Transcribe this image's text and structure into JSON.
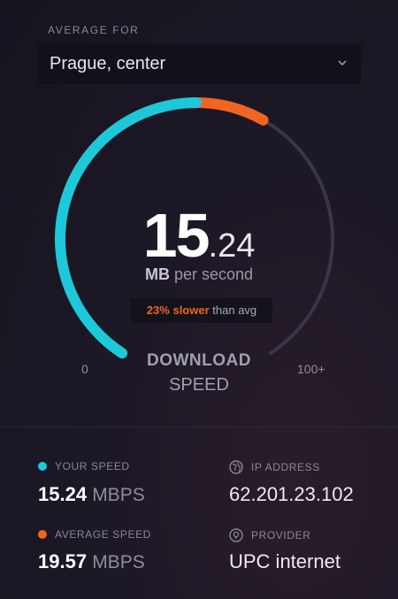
{
  "header": {
    "average_for_label": "AVERAGE FOR",
    "location": "Prague, center"
  },
  "gauge": {
    "speed_integer": "15",
    "speed_decimal": ".24",
    "unit_bold": "MB",
    "unit_rest": "per second",
    "compare_highlight": "23% slower",
    "compare_rest": "than avg",
    "scale_min": "0",
    "scale_max": "100+",
    "mode_line1": "DOWNLOAD",
    "mode_line2": "SPEED",
    "your_speed_fraction": 0.5,
    "average_speed_fraction": 0.6,
    "colors": {
      "your": "#1dc8d8",
      "average": "#f06523",
      "track": "#3a3644"
    }
  },
  "stats": {
    "your_speed": {
      "label": "YOUR SPEED",
      "value": "15.24",
      "unit": "MBPS",
      "color": "#1dc8d8"
    },
    "average_speed": {
      "label": "AVERAGE SPEED",
      "value": "19.57",
      "unit": "MBPS",
      "color": "#f06523"
    },
    "ip_address": {
      "label": "IP ADDRESS",
      "value": "62.201.23.102",
      "icon": "globe-icon"
    },
    "provider": {
      "label": "PROVIDER",
      "value": "UPC internet",
      "icon": "provider-icon"
    }
  }
}
